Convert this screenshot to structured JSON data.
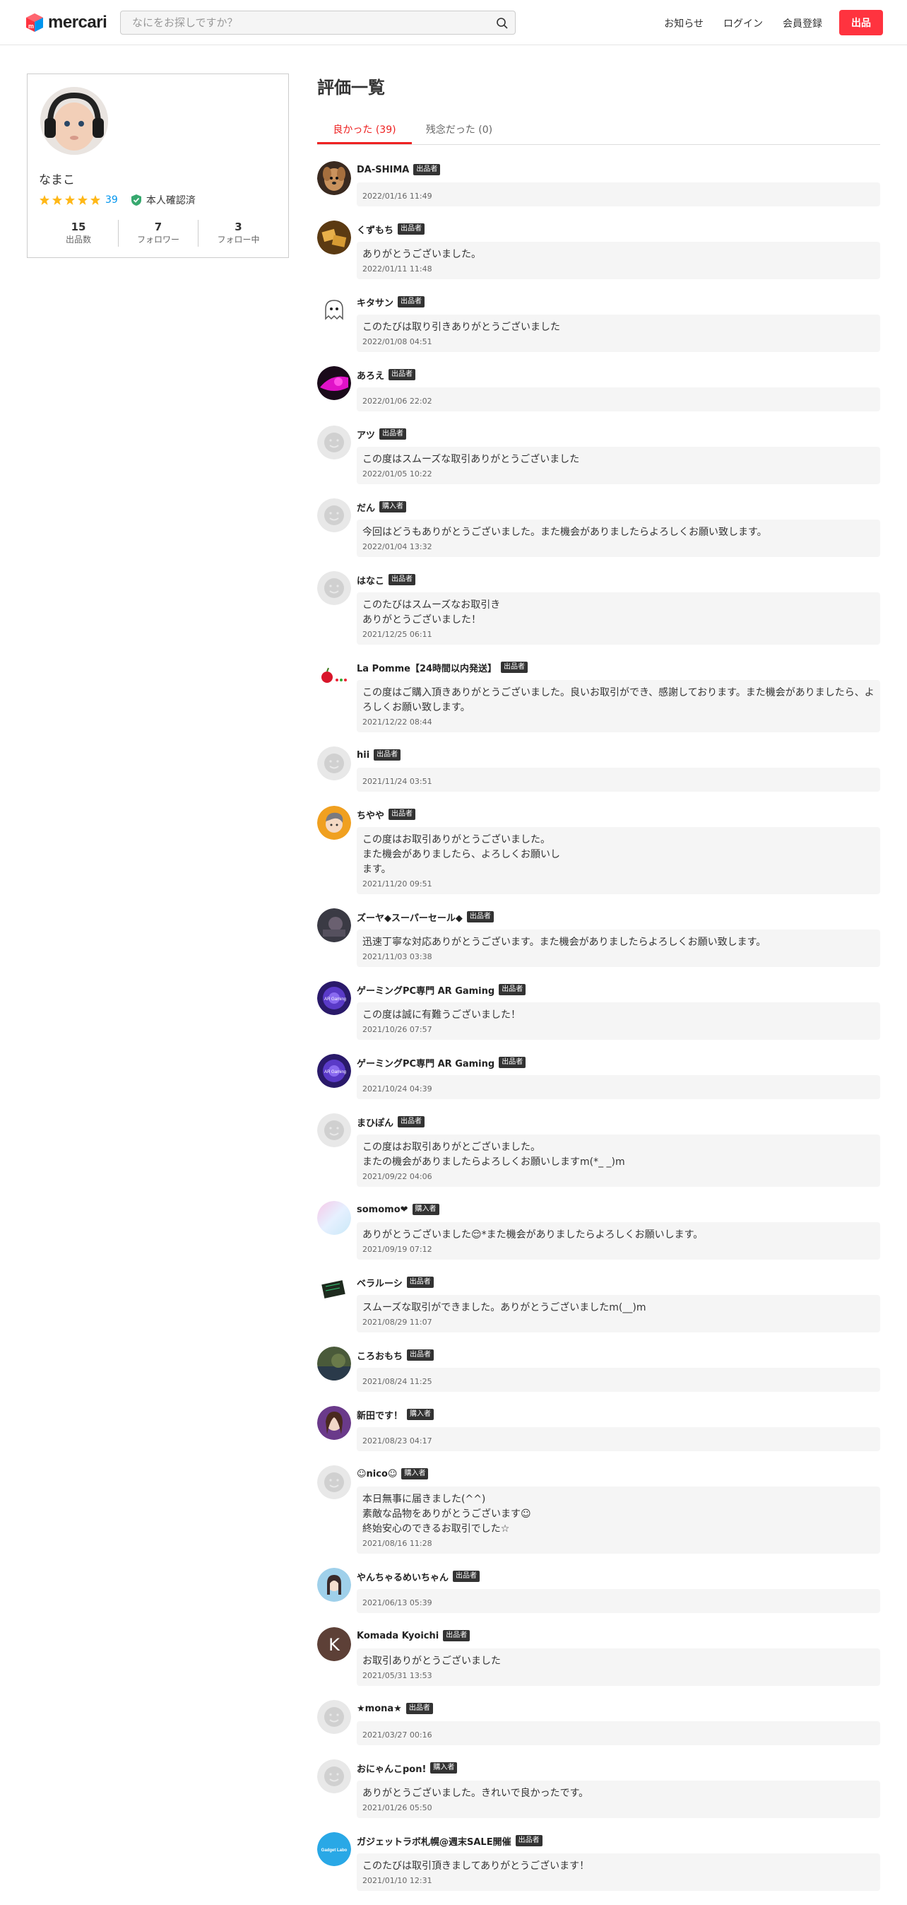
{
  "header": {
    "logo_text": "mercari",
    "search_placeholder": "なにをお探しですか？",
    "nav": [
      "お知らせ",
      "ログイン",
      "会員登録"
    ],
    "sell_label": "出品"
  },
  "profile": {
    "name": "なまこ",
    "rating_count": "39",
    "verified_label": "本人確認済",
    "stats": [
      {
        "num": "15",
        "label": "出品数"
      },
      {
        "num": "7",
        "label": "フォロワー"
      },
      {
        "num": "3",
        "label": "フォロー中"
      }
    ]
  },
  "main": {
    "title": "評価一覧",
    "tabs": [
      "良かった (39)",
      "残念だった (0)"
    ]
  },
  "reviews": [
    {
      "name": "DA-SHIMA",
      "role": "出品者",
      "text": "",
      "date": "2022/01/16 11:49",
      "avatar": "dog"
    },
    {
      "name": "くずもち",
      "role": "出品者",
      "text": "ありがとうございました。",
      "date": "2022/01/11 11:48",
      "avatar": "food"
    },
    {
      "name": "キタサン",
      "role": "出品者",
      "text": "このたびは取り引きありがとうございました",
      "date": "2022/01/08 04:51",
      "avatar": "ghost"
    },
    {
      "name": "あろえ",
      "role": "出品者",
      "text": "",
      "date": "2022/01/06 22:02",
      "avatar": "magenta"
    },
    {
      "name": "アツ",
      "role": "出品者",
      "text": "この度はスムーズな取引ありがとうございました",
      "date": "2022/01/05 10:22",
      "avatar": "default"
    },
    {
      "name": "だん",
      "role": "購入者",
      "text": "今回はどうもありがとうございました。また機会がありましたらよろしくお願い致します。",
      "date": "2022/01/04 13:32",
      "avatar": "default"
    },
    {
      "name": "はなこ",
      "role": "出品者",
      "text": "このたびはスムーズなお取引き\nありがとうございました！",
      "date": "2021/12/25 06:11",
      "avatar": "default"
    },
    {
      "name": "La Pomme【24時間以内発送】",
      "role": "出品者",
      "text": "この度はご購入頂きありがとうございました。良いお取引ができ、感謝しております。また機会がありましたら、よろしくお願い致します。",
      "date": "2021/12/22 08:44",
      "avatar": "apple"
    },
    {
      "name": "hii",
      "role": "出品者",
      "text": "",
      "date": "2021/11/24 03:51",
      "avatar": "default"
    },
    {
      "name": "ちやや",
      "role": "出品者",
      "text": "この度はお取引ありがとうございました。\nまた機会がありましたら、よろしくお願いし\nます。",
      "date": "2021/11/20 09:51",
      "avatar": "anime"
    },
    {
      "name": "ズーヤ◆スーパーセール◆",
      "role": "出品者",
      "text": "迅速丁寧な対応ありがとうございます。また機会がありましたらよろしくお願い致します。",
      "date": "2021/11/03 03:38",
      "avatar": "dark"
    },
    {
      "name": "ゲーミングPC専門 AR Gaming",
      "role": "出品者",
      "text": "この度は誠に有難うございました！",
      "date": "2021/10/26 07:57",
      "avatar": "purple"
    },
    {
      "name": "ゲーミングPC専門 AR Gaming",
      "role": "出品者",
      "text": "",
      "date": "2021/10/24 04:39",
      "avatar": "purple"
    },
    {
      "name": "まひぽん",
      "role": "出品者",
      "text": "この度はお取引ありがとございました。\nまたの機会がありましたらよろしくお願いしますm(*_ _)m",
      "date": "2021/09/22 04:06",
      "avatar": "default"
    },
    {
      "name": "somomo❤",
      "role": "購入者",
      "text": "ありがとうございました😌*また機会がありましたらよろしくお願いします。",
      "date": "2021/09/19 07:12",
      "avatar": "pastel"
    },
    {
      "name": "ベラルーシ",
      "role": "出品者",
      "text": "スムーズな取引ができました。ありがとうございましたm(__)m",
      "date": "2021/08/29 11:07",
      "avatar": "board"
    },
    {
      "name": "ころおもち",
      "role": "出品者",
      "text": "",
      "date": "2021/08/24 11:25",
      "avatar": "photo"
    },
    {
      "name": "新田です！",
      "role": "購入者",
      "text": "",
      "date": "2021/08/23 04:17",
      "avatar": "portrait"
    },
    {
      "name": "☺nico☺",
      "role": "購入者",
      "text": "本日無事に届きました(^^)\n素敵な品物をありがとうございます☺\n終始安心のできるお取引でした☆",
      "date": "2021/08/16 11:28",
      "avatar": "default"
    },
    {
      "name": "やんちゃるめいちゃん",
      "role": "出品者",
      "text": "",
      "date": "2021/06/13 05:39",
      "avatar": "girl"
    },
    {
      "name": "Komada Kyoichi",
      "role": "出品者",
      "text": "お取引ありがとうございました",
      "date": "2021/05/31 13:53",
      "avatar": "letter-k"
    },
    {
      "name": "★mona★",
      "role": "出品者",
      "text": "",
      "date": "2021/03/27 00:16",
      "avatar": "default"
    },
    {
      "name": "おにゃんこpon!",
      "role": "購入者",
      "text": "ありがとうございました。きれいで良かったです。",
      "date": "2021/01/26 05:50",
      "avatar": "default"
    },
    {
      "name": "ガジェットラボ札幌@週末SALE開催",
      "role": "出品者",
      "text": "このたびは取引頂きましてありがとうございます！",
      "date": "2021/01/10 12:31",
      "avatar": "gadget"
    }
  ],
  "colors": {
    "brand_red": "#ff333f",
    "star": "#ffb818",
    "link_blue": "#0095ee",
    "verified_green": "#36a86e"
  }
}
